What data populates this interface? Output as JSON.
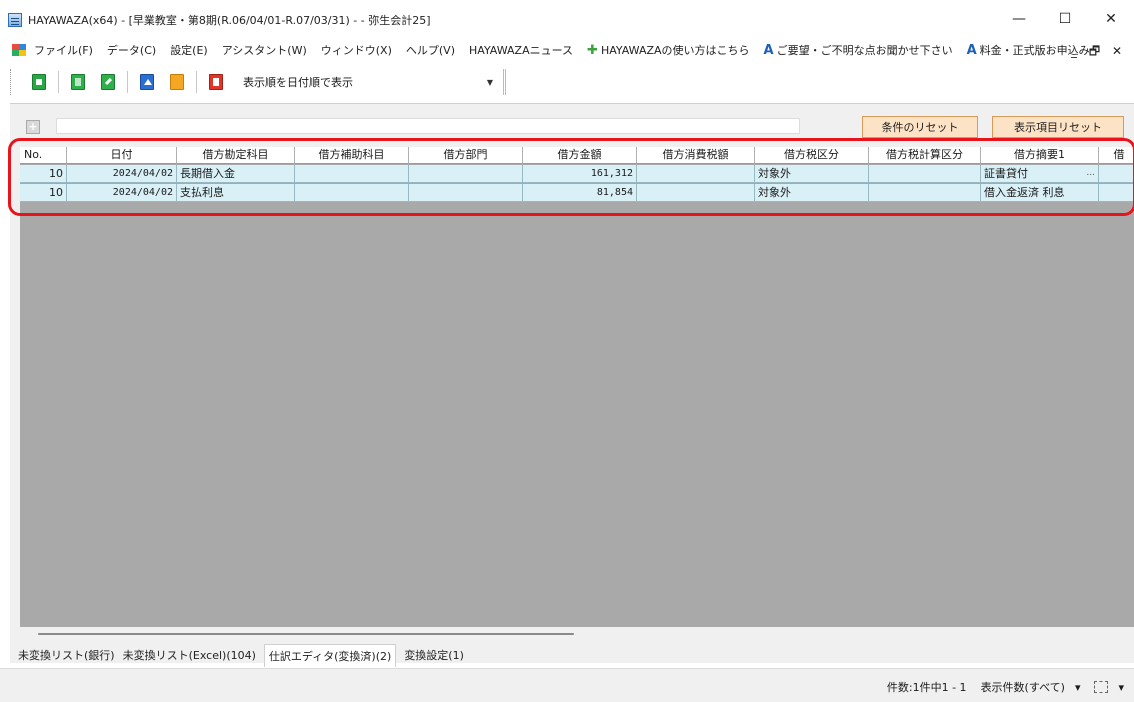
{
  "window": {
    "title": "HAYAWAZA(x64) - [早業教室・第8期(R.06/04/01-R.07/03/31) - - 弥生会計25]",
    "controls": {
      "minimize": "—",
      "maximize": "☐",
      "close": "✕"
    }
  },
  "menu": {
    "items": [
      "ファイル(F)",
      "データ(C)",
      "設定(E)",
      "アシスタント(W)",
      "ウィンドウ(X)",
      "ヘルプ(V)",
      "HAYAWAZAニュース"
    ],
    "howto": "HAYAWAZAの使い方はこちら",
    "request": "ご要望・ご不明な点お聞かせ下さい",
    "pricing": "料金・正式版お申込み",
    "mdi_controls": "_ 🗗 ✕"
  },
  "toolbar": {
    "sort_select": "表示順を日付順で表示"
  },
  "filter": {
    "expand_symbol": "+",
    "reset_conditions": "条件のリセット",
    "reset_columns": "表示項目リセット"
  },
  "grid": {
    "columns": [
      "No.",
      "日付",
      "借方勘定科目",
      "借方補助科目",
      "借方部門",
      "借方金額",
      "借方消費税額",
      "借方税区分",
      "借方税計算区分",
      "借方摘要1",
      "借"
    ],
    "rows": [
      {
        "no": "10",
        "date": "2024/04/02",
        "account": "長期借入金",
        "sub": "",
        "dept": "",
        "amount": "161,312",
        "tax": "",
        "tax_class": "対象外",
        "tax_calc": "",
        "memo": "証書貸付",
        "memo_btn": "..."
      },
      {
        "no": "10",
        "date": "2024/04/02",
        "account": "支払利息",
        "sub": "",
        "dept": "",
        "amount": "81,854",
        "tax": "",
        "tax_class": "対象外",
        "tax_calc": "",
        "memo": "借入金返済 利息",
        "memo_btn": ""
      }
    ]
  },
  "tabs": [
    "未変換リスト(銀行)",
    "未変換リスト(Excel)(104)",
    "仕訳エディタ(変換済)(2)",
    "変換設定(1)"
  ],
  "status": {
    "count": "件数:1件中1 - 1",
    "display_count": "表示件数(すべて)",
    "dd_arrow": "▾"
  },
  "colors": {
    "row_bg": "#d9f0f7",
    "grid_bg": "#a9a9a9",
    "button_bg": "#fde3c5",
    "highlight": "#e8141c"
  }
}
